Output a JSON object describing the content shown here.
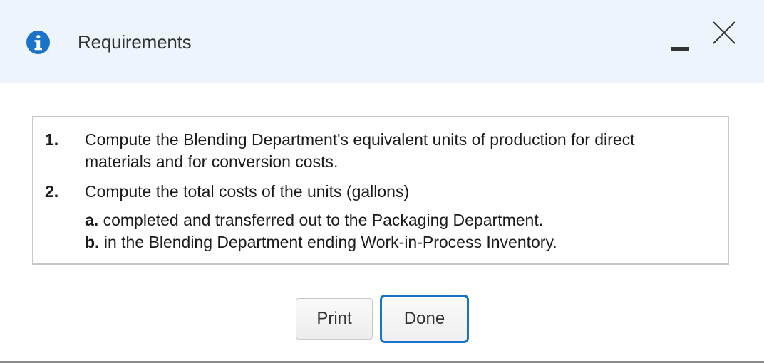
{
  "dialog": {
    "title": "Requirements",
    "icons": {
      "info": "info-icon",
      "minimize": "minimize-icon",
      "close": "close-icon"
    },
    "colors": {
      "header_bg": "#eef4fb",
      "info_icon": "#1a73c8",
      "done_border": "#1a73c8"
    }
  },
  "requirements": [
    {
      "number": "1.",
      "lines": [
        "Compute the Blending Department's equivalent units of production for direct",
        "materials and for conversion costs."
      ]
    },
    {
      "number": "2.",
      "lines": [
        "Compute the total costs of the units (gallons)"
      ],
      "subitems": [
        {
          "label": "a.",
          "text": " completed and transferred out to the Packaging Department."
        },
        {
          "label": "b.",
          "text": " in the Blending Department ending Work-in-Process Inventory."
        }
      ]
    }
  ],
  "buttons": {
    "print_label": "Print",
    "done_label": "Done"
  }
}
